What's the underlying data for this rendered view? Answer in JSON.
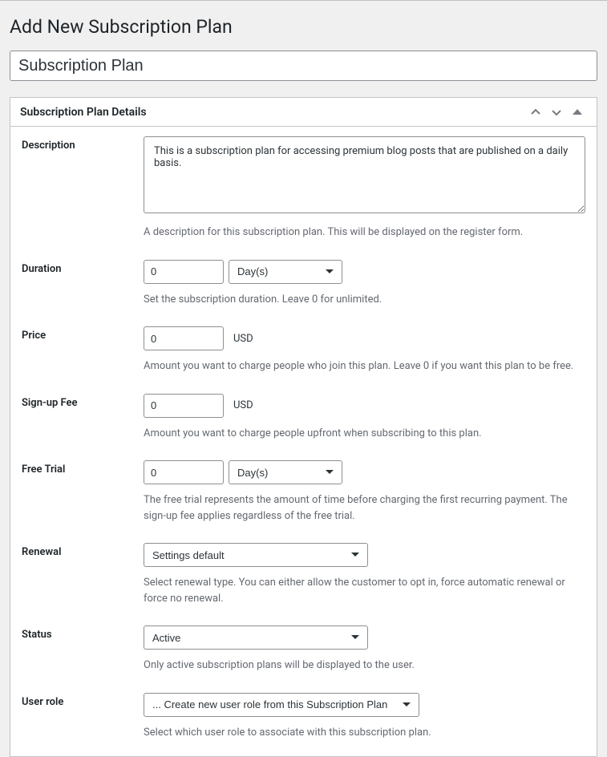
{
  "page": {
    "heading": "Add New Subscription Plan",
    "title_value": "Subscription Plan"
  },
  "panel": {
    "title": "Subscription Plan Details"
  },
  "fields": {
    "description": {
      "label": "Description",
      "value": "This is a subscription plan for accessing premium blog posts that are published on a daily basis.",
      "help": "A description for this subscription plan. This will be displayed on the register form."
    },
    "duration": {
      "label": "Duration",
      "value": "0",
      "unit": "Day(s)",
      "help": "Set the subscription duration. Leave 0 for unlimited."
    },
    "price": {
      "label": "Price",
      "value": "0",
      "currency": "USD",
      "help": "Amount you want to charge people who join this plan. Leave 0 if you want this plan to be free."
    },
    "signup_fee": {
      "label": "Sign-up Fee",
      "value": "0",
      "currency": "USD",
      "help": "Amount you want to charge people upfront when subscribing to this plan."
    },
    "free_trial": {
      "label": "Free Trial",
      "value": "0",
      "unit": "Day(s)",
      "help": "The free trial represents the amount of time before charging the first recurring payment. The sign-up fee applies regardless of the free trial."
    },
    "renewal": {
      "label": "Renewal",
      "value": "Settings default",
      "help": "Select renewal type. You can either allow the customer to opt in, force automatic renewal or force no renewal."
    },
    "status": {
      "label": "Status",
      "value": "Active",
      "help": "Only active subscription plans will be displayed to the user."
    },
    "user_role": {
      "label": "User role",
      "value": "... Create new user role from this Subscription Plan",
      "help": "Select which user role to associate with this subscription plan."
    }
  }
}
